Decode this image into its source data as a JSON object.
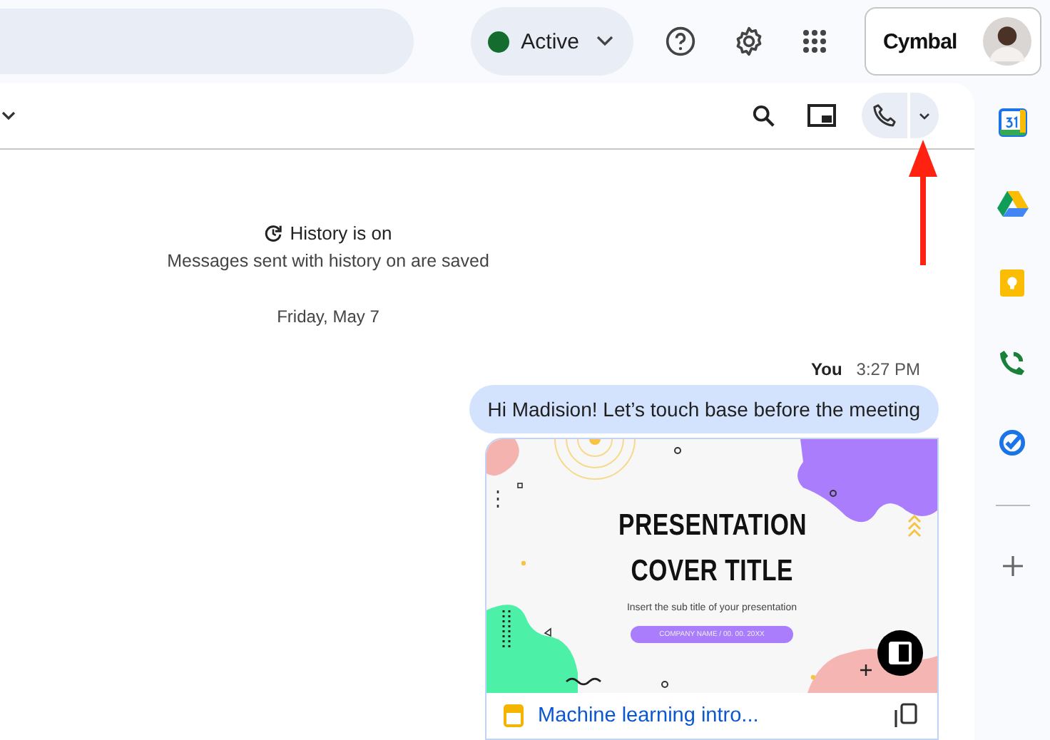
{
  "status": {
    "label": "Active"
  },
  "brand": {
    "logo": "Cymbal"
  },
  "history": {
    "title": "History is on",
    "note": "Messages sent with history on are saved"
  },
  "date_divider": "Friday, May 7",
  "messages": [
    {
      "sender": "You",
      "time": "3:27 PM",
      "text": "Hi Madision! Let’s touch base before the meeting",
      "attachment": {
        "slide_title_lines": [
          "PRESENTATION",
          "COVER TITLE"
        ],
        "slide_subtitle": "Insert the sub title of your presentation",
        "slide_tag": "COMPANY NAME / 00. 00. 20XX",
        "file_name": "Machine learning intro..."
      }
    }
  ]
}
